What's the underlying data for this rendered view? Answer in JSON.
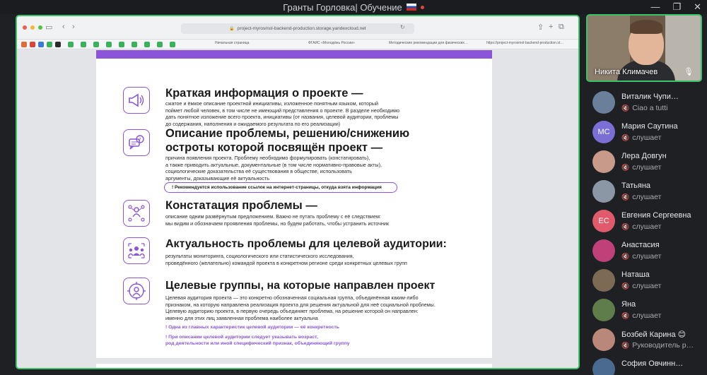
{
  "window": {
    "title": "Гранты Горловка| Обучение",
    "controls": [
      "—",
      "❐",
      "✕"
    ]
  },
  "browser": {
    "url": "project-myrosmol-backend-production.storage.yandexcloud.net",
    "tabs": [
      "Начальная страница",
      "ФГАИС «Молодёжь России»",
      "Методические рекомендации для физических…",
      "https://project-myrosmol-backend-production.st…"
    ]
  },
  "document": {
    "sections": [
      {
        "icon": "megaphone-icon",
        "title": "Краткая информация о проекте —",
        "text": [
          "сжатое и ёмкое описание проектной инициативы, изложенное понятным языком, который",
          "поймет любой человек, в том числе не имеющий представления о проекте. В разделе необходимо",
          "дать понятное изложение всего проекта, инициативы (от названия, целевой аудитории, проблемы",
          "до содержания, наполнения и ожидаемого результата по его реализации)"
        ]
      },
      {
        "icon": "chat-question-icon",
        "title": "Описание проблемы, решению/снижению",
        "title2": "остроты которой посвящён проект —",
        "text": [
          "причина появления проекта. Проблему необходимо формулировать (констатировать),",
          "а также приводить актуальные, документальные (в том числе нормативно-правовые акты),",
          "социологические доказательства её существования в обществе, использовать",
          "аргументы, доказывающие её актуальность"
        ],
        "pill": "! Рекомендуется использование ссылок на интернет-страницы, откуда взята информация"
      },
      {
        "icon": "people-network-icon",
        "title": "Констатация проблемы —",
        "text": [
          "описание одним развёрнутым предложением. Важно не путать проблему с её следствием:",
          "мы видим и обозначаем проявления проблемы, но будем работать, чтобы устранить источник"
        ]
      },
      {
        "icon": "group-icon",
        "title": "Актуальность проблемы для целевой аудитории:",
        "text": [
          "результаты мониторинга, социологического или статистического исследования,",
          "проведённого (желательно) командой проекта в конкретном регионе  среди конкретных целевых групп"
        ]
      },
      {
        "icon": "target-person-icon",
        "title": "Целевые группы, на которые направлен проект",
        "text": [
          "Целевая аудитория проекта — это конкретно обозначенная социальная группа, объединённая каким-либо",
          "признаком, на которую направлена реализация проекта для решения актуальной для неё социальной проблемы.",
          "Целевую аудиторию проекта, в первую очередь объединяет проблема, на решение которой он направлен:",
          "именно для этих лиц заявленная проблема наиболее актуальна"
        ],
        "notes": [
          "! Одна из главных характеристик целевой аудитории — её конкретность",
          "! При описании целевой аудитории следует указывать возраст,",
          "род деятельности или иной специфический признак, объединяющий группу"
        ]
      }
    ]
  },
  "camera": {
    "name": "Никита Климачев"
  },
  "participants": [
    {
      "name": "Виталик Чупи…",
      "status": "Ciao a tutti",
      "initials": "",
      "color": "#6a7f9a"
    },
    {
      "name": "Мария Саутина",
      "status": "слушает",
      "initials": "МС",
      "color": "#7b6fd6"
    },
    {
      "name": "Лера Довгун",
      "status": "слушает",
      "initials": "",
      "color": "#c79a8a"
    },
    {
      "name": "Татьяна",
      "status": "слушает",
      "initials": "",
      "color": "#8c97a6"
    },
    {
      "name": "Евгения Сергеевна",
      "status": "слушает",
      "initials": "ЕС",
      "color": "#e05a6b"
    },
    {
      "name": "Анастасия",
      "status": "слушает",
      "initials": "",
      "color": "#c0407a"
    },
    {
      "name": "Наташа",
      "status": "слушает",
      "initials": "",
      "color": "#7d6a55"
    },
    {
      "name": "Яна",
      "status": "слушает",
      "initials": "",
      "color": "#5f7d4a"
    },
    {
      "name": "Бозбей Карина 😊",
      "status": "Руководитель р…",
      "initials": "",
      "color": "#b9887a"
    },
    {
      "name": "София Овчинн…",
      "status": "",
      "initials": "",
      "color": "#4a6a8f"
    }
  ],
  "colors": {
    "accent": "#8a55d9",
    "active_border": "#3cc36a"
  }
}
